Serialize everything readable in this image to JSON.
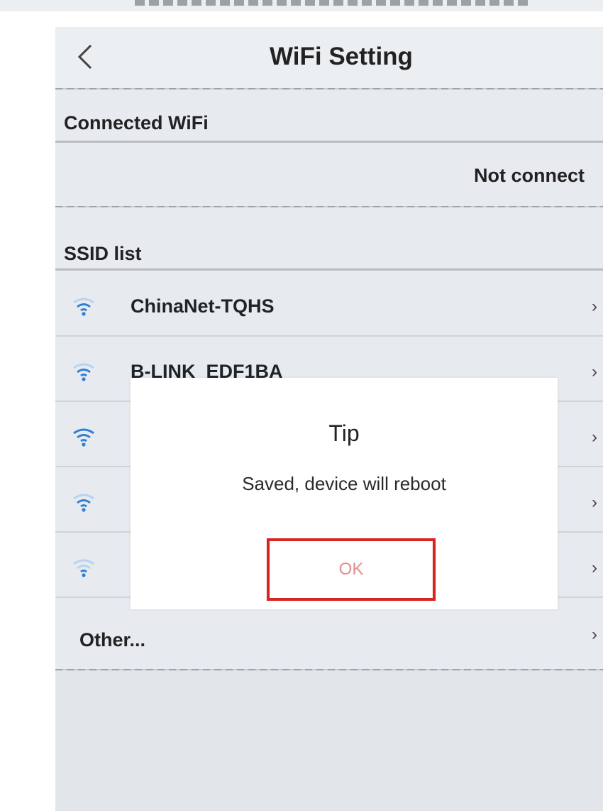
{
  "nav": {
    "title": "WiFi Setting",
    "back_icon": "chevron-left-icon"
  },
  "connected": {
    "header": "Connected WiFi",
    "status": "Not connect"
  },
  "ssid_list": {
    "header": "SSID list",
    "items": [
      {
        "label": "ChinaNet-TQHS",
        "signal_bars": 2
      },
      {
        "label": "B-LINK_EDF1BA",
        "signal_bars": 2
      },
      {
        "label": "",
        "signal_bars": 3
      },
      {
        "label": "",
        "signal_bars": 2
      },
      {
        "label": "",
        "signal_bars": 1
      }
    ],
    "other_label": "Other...",
    "chevron": "›"
  },
  "dialog": {
    "title": "Tip",
    "message": "Saved, device will reboot",
    "ok_label": "OK"
  },
  "colors": {
    "wifi_icon": "#2f7fd6",
    "ok_highlight_border": "#d92424",
    "ok_text": "#f08a8a",
    "screen_background": "#e7eaee"
  }
}
